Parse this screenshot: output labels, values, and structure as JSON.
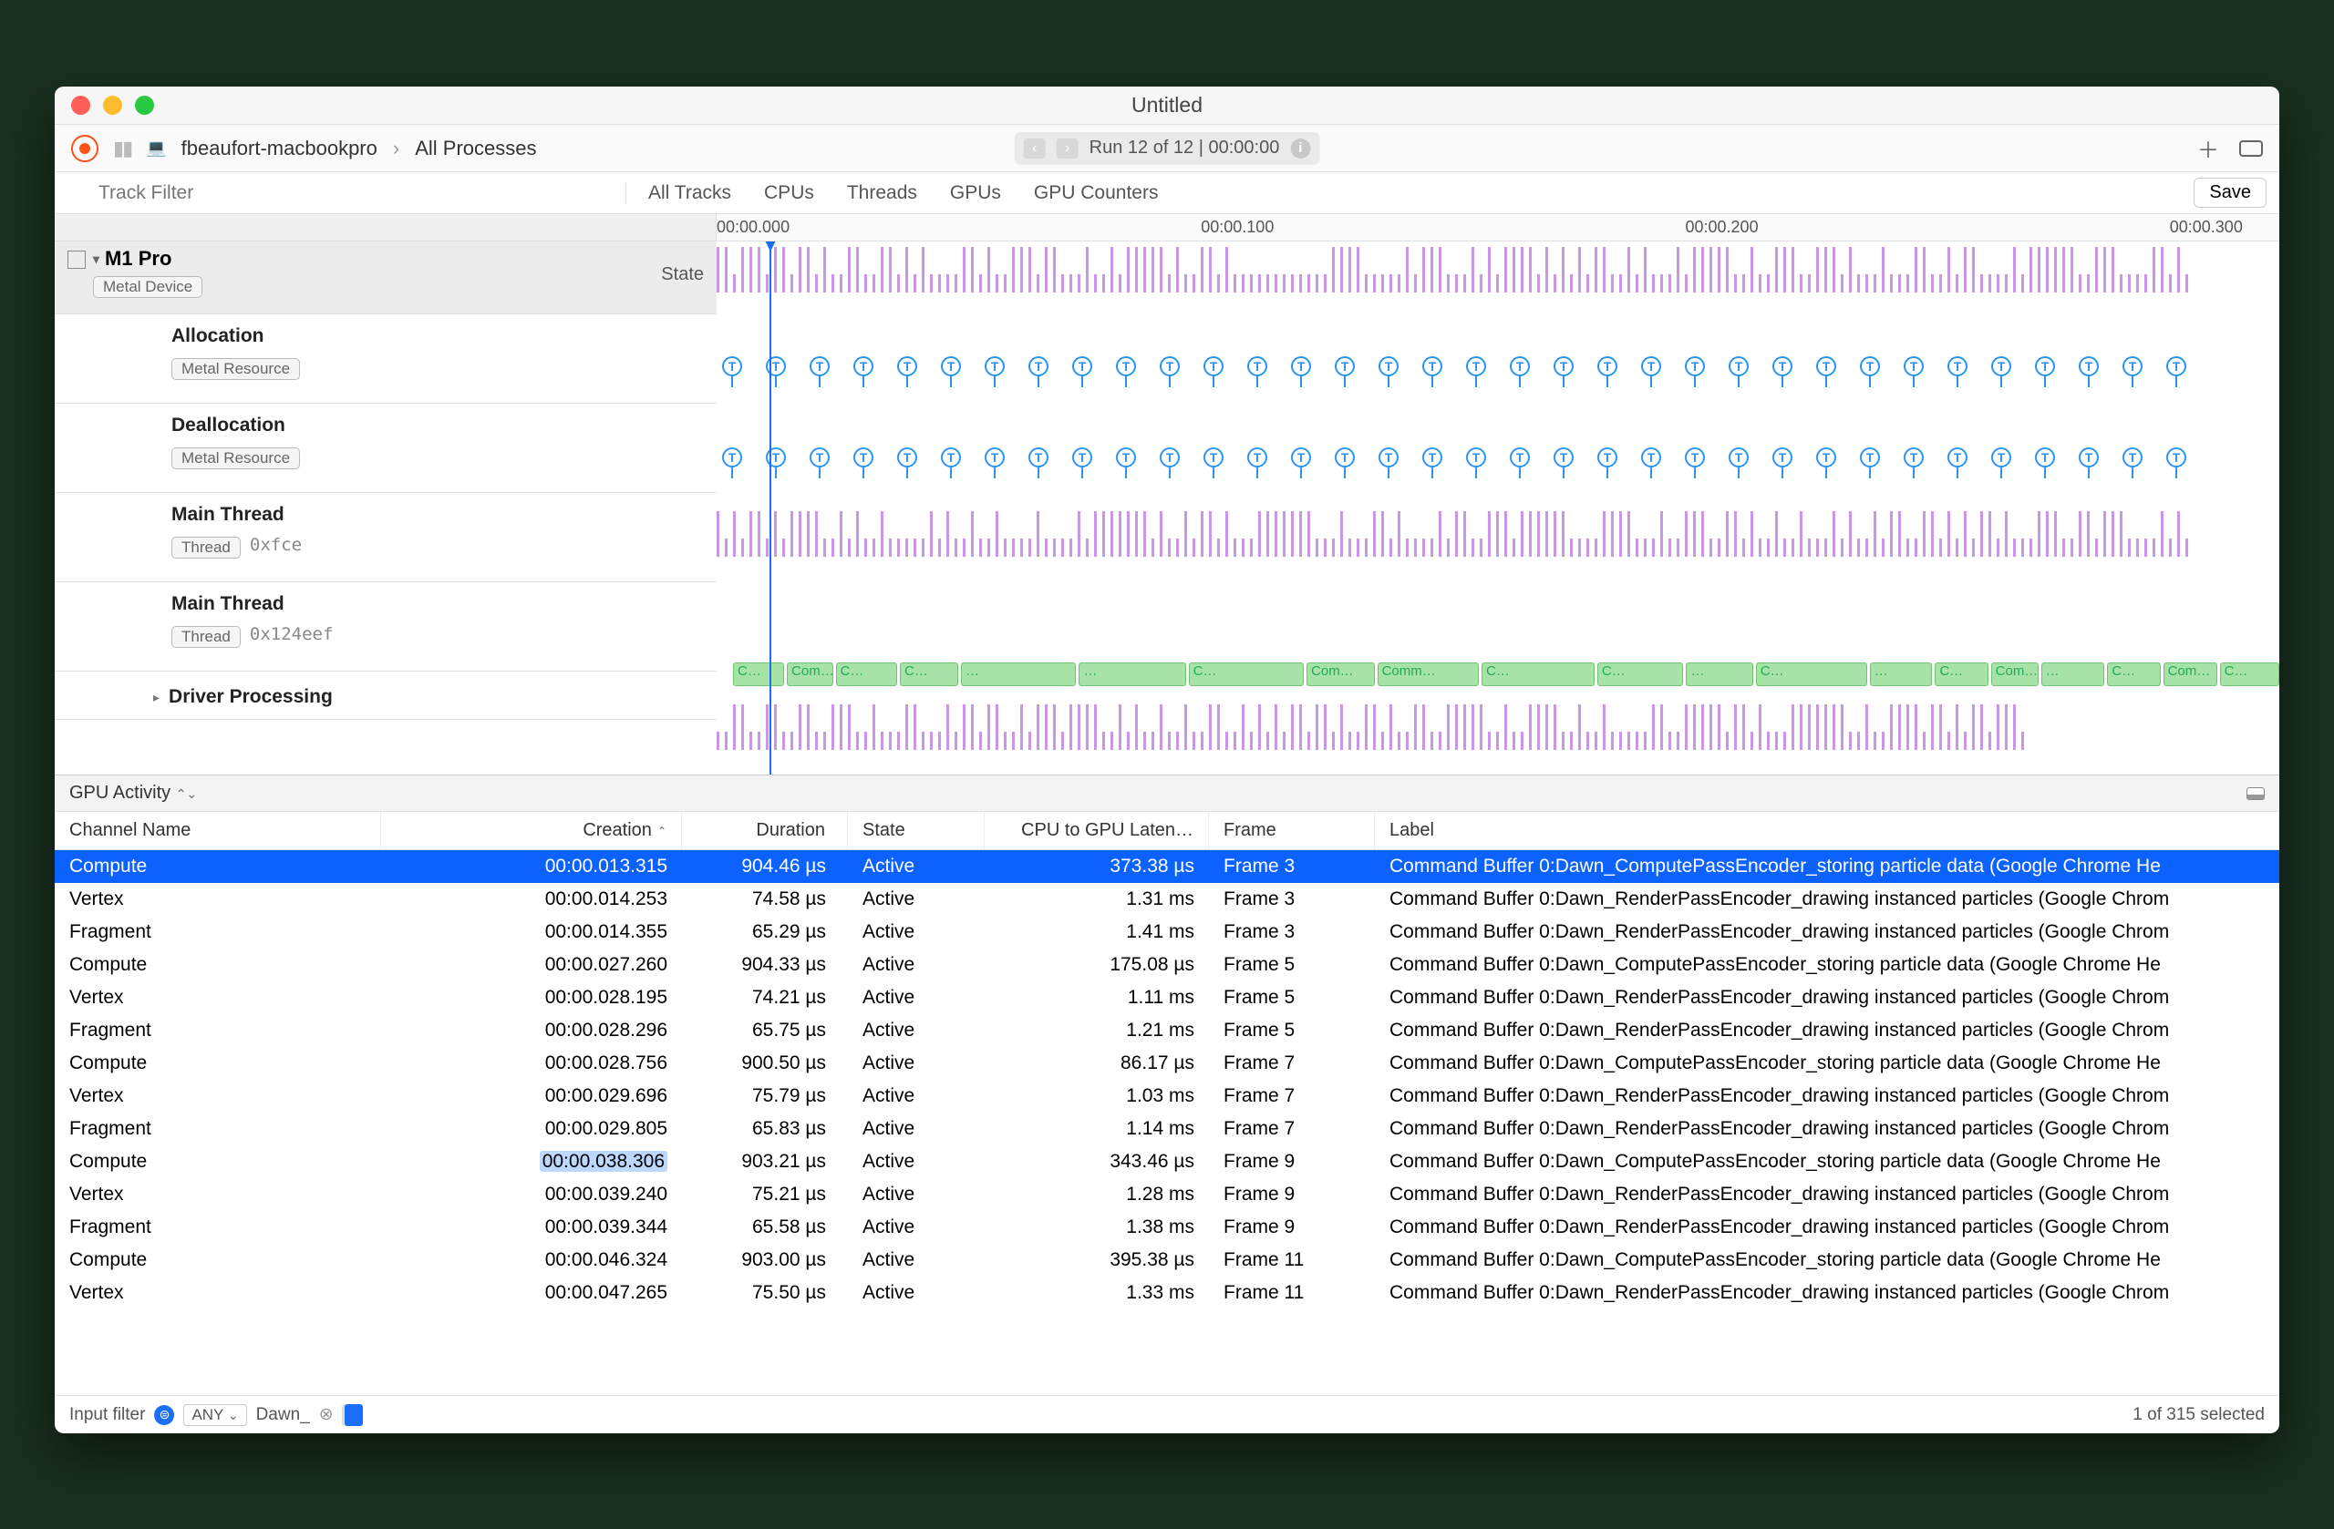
{
  "window_title": "Untitled",
  "breadcrumb": {
    "host": "fbeaufort-macbookpro",
    "target": "All Processes"
  },
  "run_pill": "Run 12 of 12  |  00:00:00",
  "track_filter_placeholder": "Track Filter",
  "tabs": [
    "All Tracks",
    "CPUs",
    "Threads",
    "GPUs",
    "GPU Counters"
  ],
  "save_label": "Save",
  "ruler_ticks": [
    "00:00.000",
    "00:00.100",
    "00:00.200",
    "00:00.300"
  ],
  "state_header": "State",
  "device": {
    "name": "M1 Pro",
    "chip": "Metal Device"
  },
  "tracks": [
    {
      "title": "Allocation",
      "chip": "Metal Resource"
    },
    {
      "title": "Deallocation",
      "chip": "Metal Resource"
    },
    {
      "title": "Main Thread",
      "chip": "Thread",
      "hex": "0xfce"
    },
    {
      "title": "Main Thread",
      "chip": "Thread",
      "hex": "0x124eef"
    },
    {
      "title": "Driver Processing"
    }
  ],
  "green_labels": [
    "C…",
    "Com…",
    "C…",
    "C…",
    "…",
    "…",
    "C…",
    "Com…",
    "Comm…",
    "C…",
    "C…",
    "…",
    "C…",
    "…",
    "C…",
    "Com…",
    "…",
    "C…",
    "Com…",
    "C…"
  ],
  "section_title": "GPU Activity",
  "columns": {
    "name": "Channel Name",
    "creation": "Creation",
    "duration": "Duration",
    "state": "State",
    "latency": "CPU to GPU Laten…",
    "frame": "Frame",
    "label": "Label"
  },
  "rows": [
    {
      "sel": true,
      "name": "Compute",
      "creation": "00:00.013.315",
      "duration": "904.46 µs",
      "state": "Active",
      "latency": "373.38 µs",
      "frame": "Frame 3",
      "label": "Command Buffer 0:Dawn_ComputePassEncoder_storing particle data   (Google Chrome He"
    },
    {
      "name": "Vertex",
      "creation": "00:00.014.253",
      "duration": "74.58 µs",
      "state": "Active",
      "latency": "1.31 ms",
      "frame": "Frame 3",
      "label": "Command Buffer 0:Dawn_RenderPassEncoder_drawing instanced particles   (Google Chrom"
    },
    {
      "name": "Fragment",
      "creation": "00:00.014.355",
      "duration": "65.29 µs",
      "state": "Active",
      "latency": "1.41 ms",
      "frame": "Frame 3",
      "label": "Command Buffer 0:Dawn_RenderPassEncoder_drawing instanced particles   (Google Chrom"
    },
    {
      "name": "Compute",
      "creation": "00:00.027.260",
      "duration": "904.33 µs",
      "state": "Active",
      "latency": "175.08 µs",
      "frame": "Frame 5",
      "label": "Command Buffer 0:Dawn_ComputePassEncoder_storing particle data   (Google Chrome He"
    },
    {
      "name": "Vertex",
      "creation": "00:00.028.195",
      "duration": "74.21 µs",
      "state": "Active",
      "latency": "1.11 ms",
      "frame": "Frame 5",
      "label": "Command Buffer 0:Dawn_RenderPassEncoder_drawing instanced particles   (Google Chrom"
    },
    {
      "name": "Fragment",
      "creation": "00:00.028.296",
      "duration": "65.75 µs",
      "state": "Active",
      "latency": "1.21 ms",
      "frame": "Frame 5",
      "label": "Command Buffer 0:Dawn_RenderPassEncoder_drawing instanced particles   (Google Chrom"
    },
    {
      "name": "Compute",
      "creation": "00:00.028.756",
      "duration": "900.50 µs",
      "state": "Active",
      "latency": "86.17 µs",
      "frame": "Frame 7",
      "label": "Command Buffer 0:Dawn_ComputePassEncoder_storing particle data   (Google Chrome He"
    },
    {
      "name": "Vertex",
      "creation": "00:00.029.696",
      "duration": "75.79 µs",
      "state": "Active",
      "latency": "1.03 ms",
      "frame": "Frame 7",
      "label": "Command Buffer 0:Dawn_RenderPassEncoder_drawing instanced particles   (Google Chrom"
    },
    {
      "name": "Fragment",
      "creation": "00:00.029.805",
      "duration": "65.83 µs",
      "state": "Active",
      "latency": "1.14 ms",
      "frame": "Frame 7",
      "label": "Command Buffer 0:Dawn_RenderPassEncoder_drawing instanced particles   (Google Chrom"
    },
    {
      "name": "Compute",
      "creation": "00:00.038.306",
      "duration": "903.21 µs",
      "state": "Active",
      "latency": "343.46 µs",
      "frame": "Frame 9",
      "label": "Command Buffer 0:Dawn_ComputePassEncoder_storing particle data   (Google Chrome He",
      "hl": true
    },
    {
      "name": "Vertex",
      "creation": "00:00.039.240",
      "duration": "75.21 µs",
      "state": "Active",
      "latency": "1.28 ms",
      "frame": "Frame 9",
      "label": "Command Buffer 0:Dawn_RenderPassEncoder_drawing instanced particles   (Google Chrom"
    },
    {
      "name": "Fragment",
      "creation": "00:00.039.344",
      "duration": "65.58 µs",
      "state": "Active",
      "latency": "1.38 ms",
      "frame": "Frame 9",
      "label": "Command Buffer 0:Dawn_RenderPassEncoder_drawing instanced particles   (Google Chrom"
    },
    {
      "name": "Compute",
      "creation": "00:00.046.324",
      "duration": "903.00 µs",
      "state": "Active",
      "latency": "395.38 µs",
      "frame": "Frame 11",
      "label": "Command Buffer 0:Dawn_ComputePassEncoder_storing particle data   (Google Chrome He"
    },
    {
      "name": "Vertex",
      "creation": "00:00.047.265",
      "duration": "75.50 µs",
      "state": "Active",
      "latency": "1.33 ms",
      "frame": "Frame 11",
      "label": "Command Buffer 0:Dawn_RenderPassEncoder_drawing instanced particles   (Google Chrom"
    }
  ],
  "footer": {
    "input_label": "Input filter",
    "mode": "ANY",
    "query": "Dawn_",
    "selection": "1 of 315 selected"
  }
}
